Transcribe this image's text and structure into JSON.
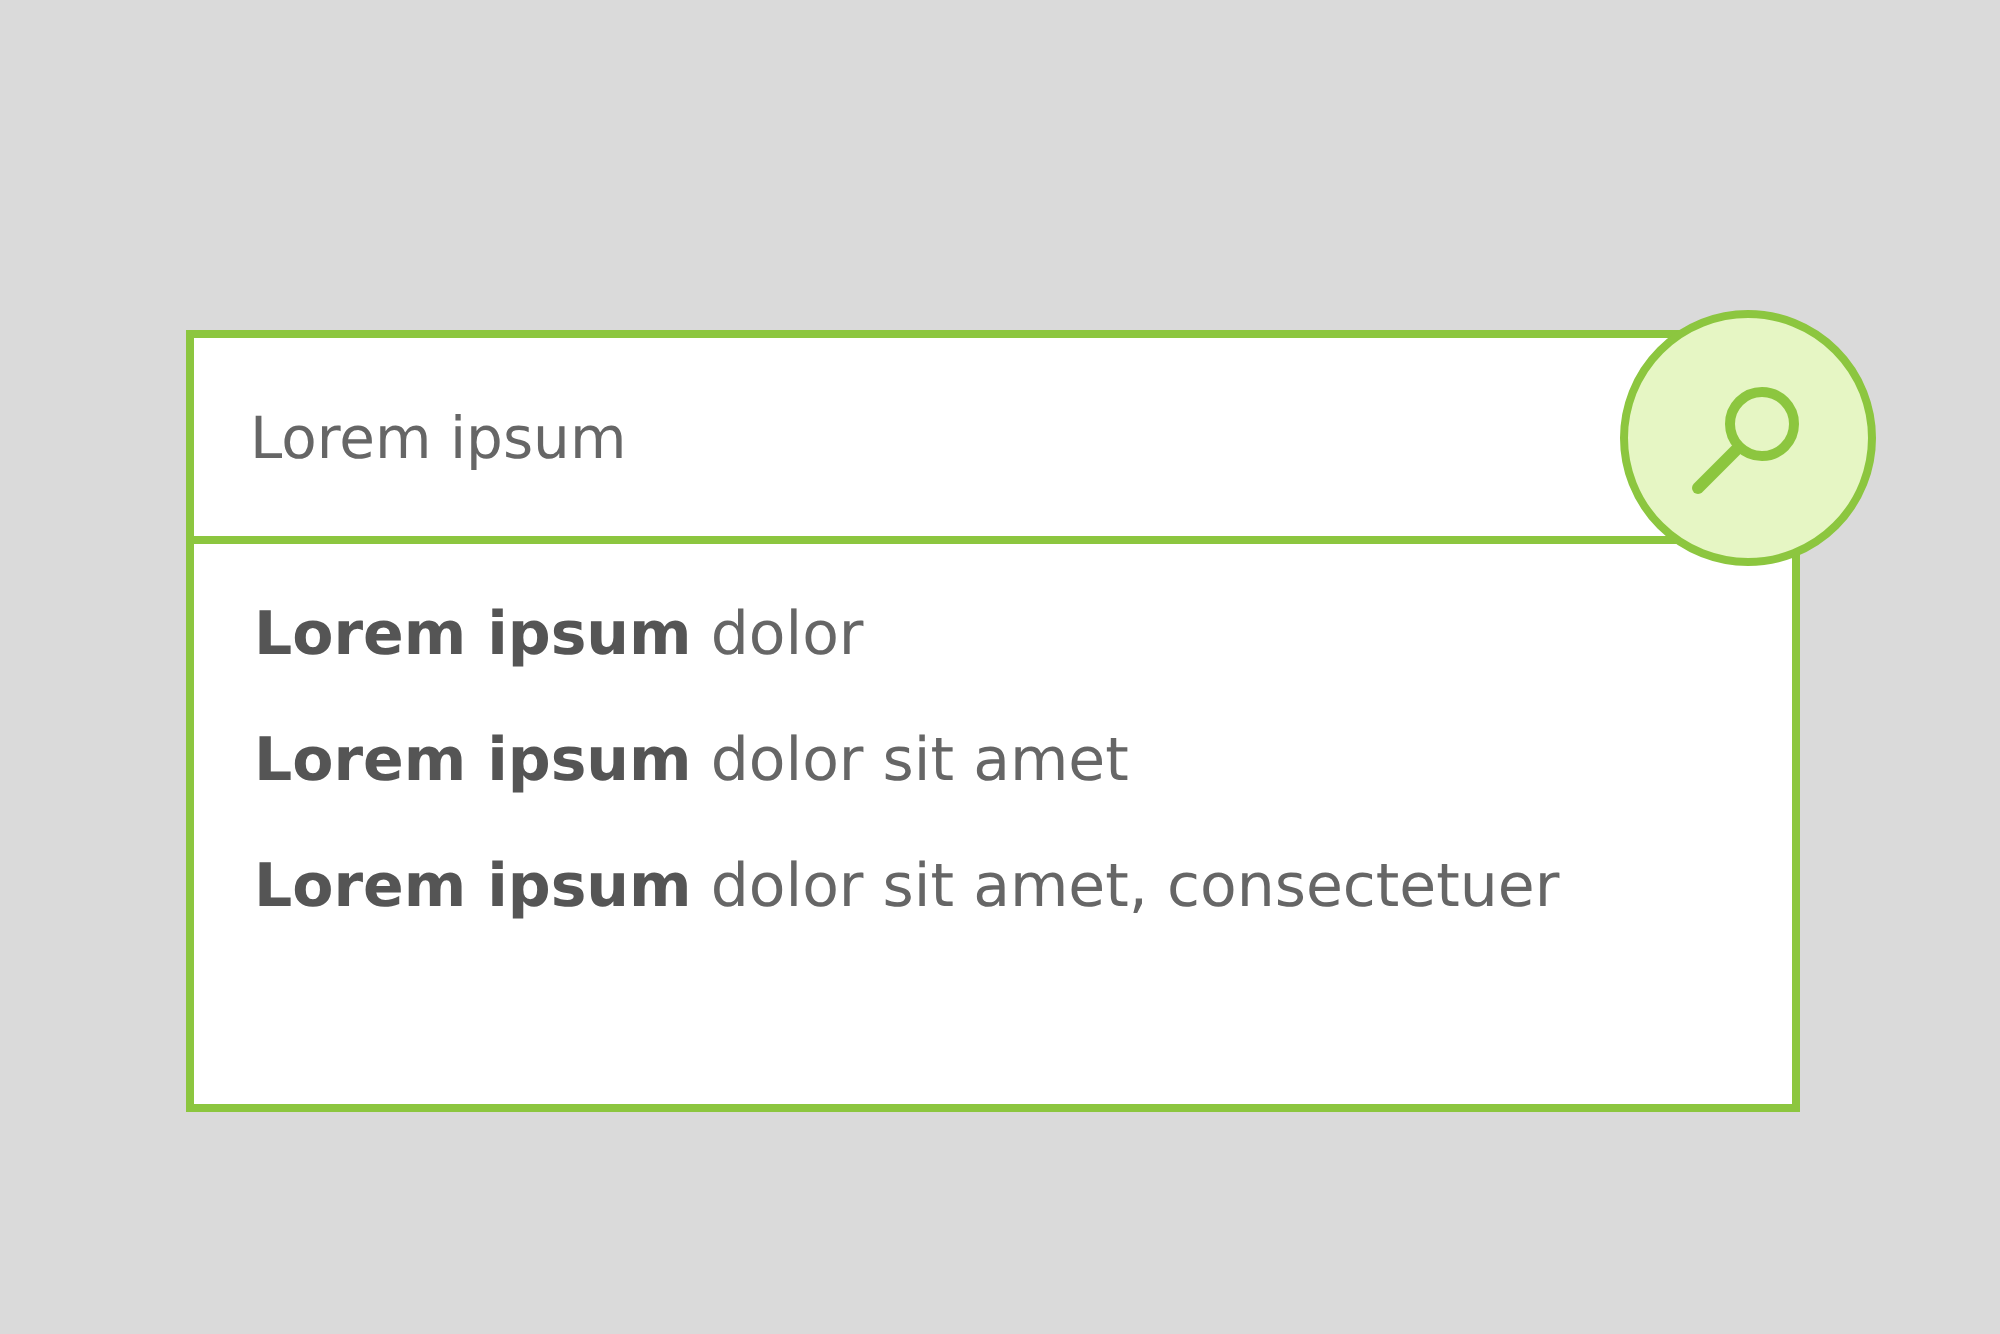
{
  "search": {
    "value": "Lorem ipsum"
  },
  "suggestions": [
    "**Lorem ipsum** dolor",
    "**Lorem ipsum** dolor sit amet",
    "**Lorem ipsum** dolor sit amet, consectetuer"
  ]
}
